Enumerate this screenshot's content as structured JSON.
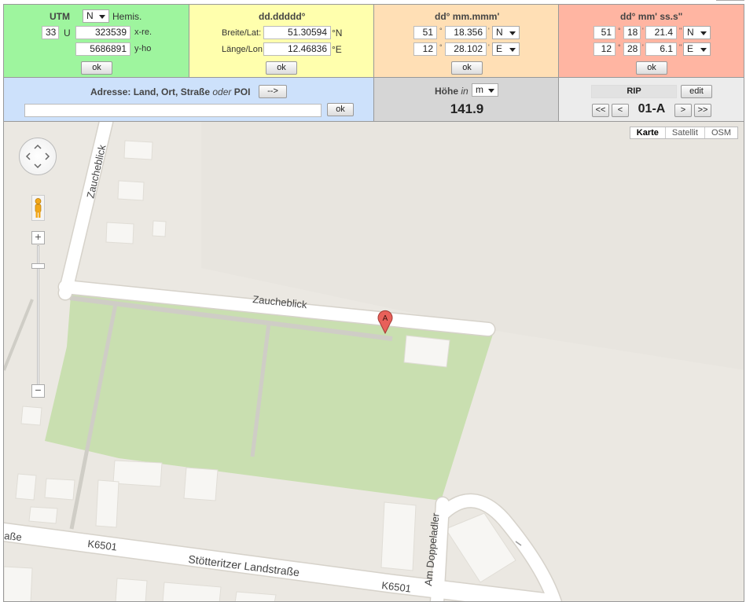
{
  "utm": {
    "title": "UTM",
    "hemis_select": "N",
    "hemis_label": "Hemis.",
    "zone": "33",
    "zone_letter": "U",
    "easting": "323539",
    "easting_label": "x-re.",
    "northing": "5686891",
    "northing_label": "y-ho",
    "ok": "ok",
    "color": "#9ef59e"
  },
  "decimal": {
    "title": "dd.ddddd°",
    "lat_label": "Breite/Lat:",
    "lat_value": "51.30594",
    "lat_unit": "°N",
    "lon_label": "Länge/Lon",
    "lon_value": "12.46836",
    "lon_unit": "°E",
    "ok": "ok",
    "color": "#ffffad"
  },
  "dm": {
    "title": "dd° mm.mmm'",
    "lat_deg": "51",
    "lat_min": "18.356",
    "lat_dir": "N",
    "lon_deg": "12",
    "lon_min": "28.102",
    "lon_dir": "E",
    "deg_sym": "°",
    "min_sym": "'",
    "ok": "ok",
    "color": "#ffdfb5"
  },
  "dms": {
    "title": "dd° mm' ss.s\"",
    "lat_deg": "51",
    "lat_min": "18",
    "lat_sec": "21.4",
    "lat_dir": "N",
    "lon_deg": "12",
    "lon_min": "28",
    "lon_sec": "6.1",
    "lon_dir": "E",
    "deg_sym": "°",
    "min_sym": "'",
    "sec_sym": "\"",
    "ok": "ok",
    "color": "#ffb5a2"
  },
  "address": {
    "title_a": "Adresse: Land, Ort, Straße ",
    "title_oder": "oder",
    "title_b": " POI",
    "arrow_button": "-->",
    "input_value": "",
    "ok": "ok",
    "color": "#cde1fb"
  },
  "height": {
    "label": "Höhe ",
    "label_in": "in",
    "unit": "m",
    "value": "141.9",
    "color": "#d6d6d6"
  },
  "nav": {
    "rip": "RIP",
    "edit": "edit",
    "first": "<<",
    "prev": "<",
    "current": "01-A",
    "next": ">",
    "last": ">>",
    "color": "#ececec"
  },
  "map": {
    "types": [
      "Karte",
      "Satellit",
      "OSM"
    ],
    "marker": "A",
    "streets": {
      "zaucheblick_1": "Zaucheblick",
      "zaucheblick_2": "Zaucheblick",
      "strasse_edge": "aße",
      "k6501_1": "K6501",
      "k6501_2": "K6501",
      "stoetteritzer": "Stötteritzer Landstraße",
      "doppeladler": "Am Doppeladler"
    },
    "colors": {
      "background": "#ebe8e2",
      "park": "#c9dfb0",
      "road": "#ffffff",
      "building": "#f7f6f3",
      "marker": "#e8615a"
    }
  }
}
